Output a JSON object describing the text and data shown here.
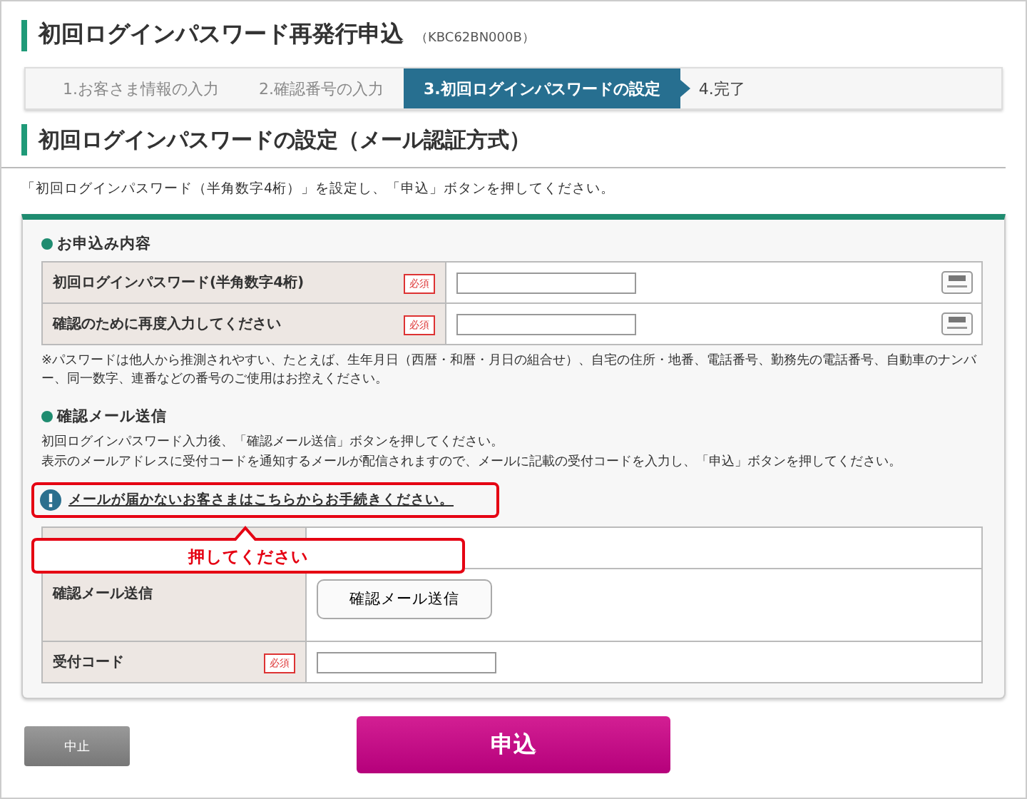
{
  "page_title": "初回ログインパスワード再発行申込",
  "screen_code": "（KBC62BN000B）",
  "steps": [
    {
      "label": "1.お客さま情報の入力",
      "selected": false
    },
    {
      "label": "2.確認番号の入力",
      "selected": false
    },
    {
      "label": "3.初回ログインパスワードの設定",
      "selected": true
    },
    {
      "label": "4.完了",
      "selected": false
    }
  ],
  "section_title": "初回ログインパスワードの設定（メール認証方式）",
  "intro": "「初回ログインパスワード（半角数字4桁）」を設定し、「申込」ボタンを押してください。",
  "application": {
    "heading": "お申込み内容",
    "rows": [
      {
        "label": "初回ログインパスワード(半角数字4桁)",
        "required": "必須"
      },
      {
        "label": "確認のために再度入力してください",
        "required": "必須"
      }
    ],
    "note": "※パスワードは他人から推測されやすい、たとえば、生年月日（西暦・和暦・月日の組合せ）、自宅の住所・地番、電話番号、勤務先の電話番号、自動車のナンバー、同一数字、連番などの番号のご使用はお控えください。"
  },
  "mail": {
    "heading": "確認メール送信",
    "lines": [
      "初回ログインパスワード入力後、「確認メール送信」ボタンを押してください。",
      "表示のメールアドレスに受付コードを通知するメールが配信されますので、メールに記載の受付コードを入力し、「申込」ボタンを押してください。"
    ],
    "link": "メールが届かないお客さまはこちらからお手続きください。",
    "callout": "押してください",
    "rows": [
      {
        "kind": "hidden"
      },
      {
        "kind": "button",
        "label": "確認メール送信",
        "button": "確認メール送信"
      },
      {
        "kind": "input",
        "label": "受付コード",
        "required": "必須"
      }
    ]
  },
  "buttons": {
    "cancel": "中止",
    "submit": "申込"
  }
}
